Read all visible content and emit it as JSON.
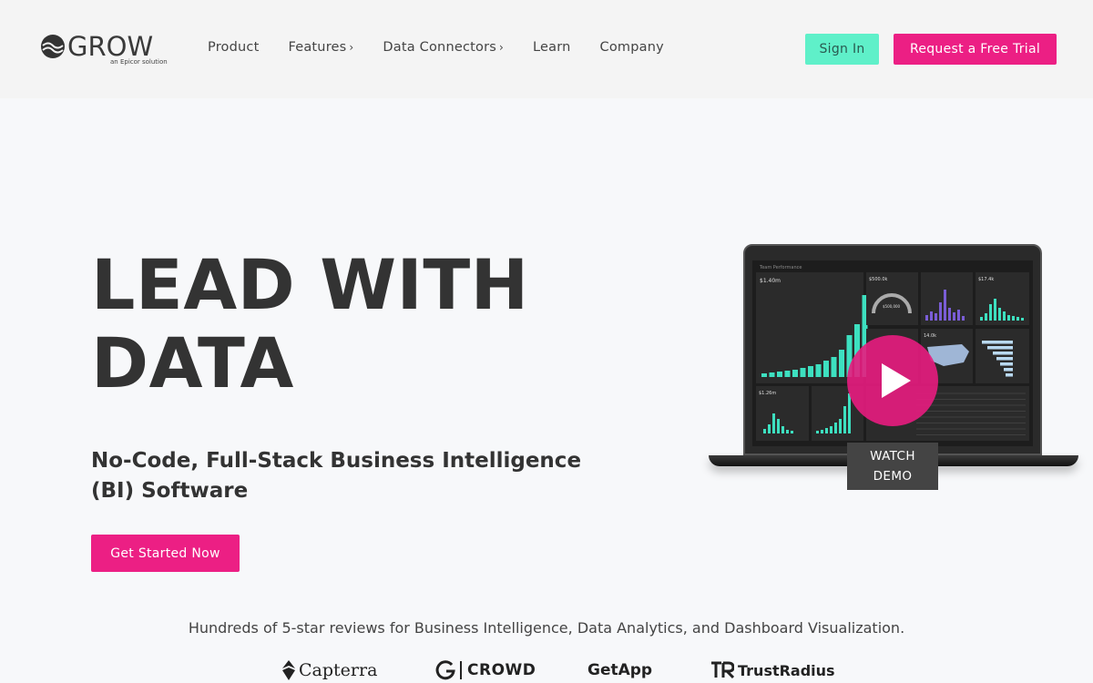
{
  "header": {
    "logo_text": "GROW",
    "logo_subtext": "an Epicor solution",
    "nav": [
      {
        "label": "Product",
        "has_submenu": false
      },
      {
        "label": "Features",
        "has_submenu": true
      },
      {
        "label": "Data Connectors",
        "has_submenu": true
      },
      {
        "label": "Learn",
        "has_submenu": false
      },
      {
        "label": "Company",
        "has_submenu": false
      }
    ],
    "chevron": "›",
    "signin_label": "Sign In",
    "trial_label": "Request a Free Trial"
  },
  "hero": {
    "title_line1": "LEAD WITH",
    "title_line2": "DATA",
    "subtitle": "No-Code, Full-Stack Business Intelligence (BI) Software",
    "cta_label": "Get Started Now"
  },
  "demo": {
    "watch_line1": "WATCH",
    "watch_line2": "DEMO",
    "icon": "play-icon",
    "dashboard_title": "Team Performance",
    "metric_1": "$1.40m",
    "metric_2": "$500.0k",
    "metric_3": "$17.4k",
    "metric_4": "14.0k",
    "metric_5": "$1.26m",
    "gauge_label": "$500,000"
  },
  "reviews": {
    "text": "Hundreds of 5-star reviews for Business Intelligence, Data Analytics, and Dashboard Visualization.",
    "badges": [
      "Capterra",
      "CROWD",
      "GetApp",
      "TrustRadius"
    ],
    "g2_mark": "G2"
  },
  "colors": {
    "accent_pink": "#ec1f84",
    "accent_mint": "#5ff0c9",
    "chart_teal": "#3de0c0"
  }
}
